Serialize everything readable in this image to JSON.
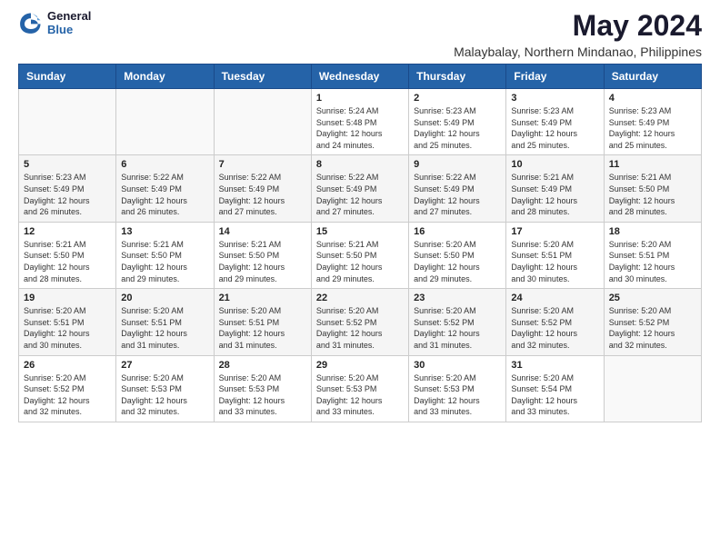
{
  "header": {
    "logo_general": "General",
    "logo_blue": "Blue",
    "month_title": "May 2024",
    "location": "Malaybalay, Northern Mindanao, Philippines"
  },
  "days_of_week": [
    "Sunday",
    "Monday",
    "Tuesday",
    "Wednesday",
    "Thursday",
    "Friday",
    "Saturday"
  ],
  "weeks": [
    [
      {
        "day": "",
        "info": ""
      },
      {
        "day": "",
        "info": ""
      },
      {
        "day": "",
        "info": ""
      },
      {
        "day": "1",
        "info": "Sunrise: 5:24 AM\nSunset: 5:48 PM\nDaylight: 12 hours\nand 24 minutes."
      },
      {
        "day": "2",
        "info": "Sunrise: 5:23 AM\nSunset: 5:49 PM\nDaylight: 12 hours\nand 25 minutes."
      },
      {
        "day": "3",
        "info": "Sunrise: 5:23 AM\nSunset: 5:49 PM\nDaylight: 12 hours\nand 25 minutes."
      },
      {
        "day": "4",
        "info": "Sunrise: 5:23 AM\nSunset: 5:49 PM\nDaylight: 12 hours\nand 25 minutes."
      }
    ],
    [
      {
        "day": "5",
        "info": "Sunrise: 5:23 AM\nSunset: 5:49 PM\nDaylight: 12 hours\nand 26 minutes."
      },
      {
        "day": "6",
        "info": "Sunrise: 5:22 AM\nSunset: 5:49 PM\nDaylight: 12 hours\nand 26 minutes."
      },
      {
        "day": "7",
        "info": "Sunrise: 5:22 AM\nSunset: 5:49 PM\nDaylight: 12 hours\nand 27 minutes."
      },
      {
        "day": "8",
        "info": "Sunrise: 5:22 AM\nSunset: 5:49 PM\nDaylight: 12 hours\nand 27 minutes."
      },
      {
        "day": "9",
        "info": "Sunrise: 5:22 AM\nSunset: 5:49 PM\nDaylight: 12 hours\nand 27 minutes."
      },
      {
        "day": "10",
        "info": "Sunrise: 5:21 AM\nSunset: 5:49 PM\nDaylight: 12 hours\nand 28 minutes."
      },
      {
        "day": "11",
        "info": "Sunrise: 5:21 AM\nSunset: 5:50 PM\nDaylight: 12 hours\nand 28 minutes."
      }
    ],
    [
      {
        "day": "12",
        "info": "Sunrise: 5:21 AM\nSunset: 5:50 PM\nDaylight: 12 hours\nand 28 minutes."
      },
      {
        "day": "13",
        "info": "Sunrise: 5:21 AM\nSunset: 5:50 PM\nDaylight: 12 hours\nand 29 minutes."
      },
      {
        "day": "14",
        "info": "Sunrise: 5:21 AM\nSunset: 5:50 PM\nDaylight: 12 hours\nand 29 minutes."
      },
      {
        "day": "15",
        "info": "Sunrise: 5:21 AM\nSunset: 5:50 PM\nDaylight: 12 hours\nand 29 minutes."
      },
      {
        "day": "16",
        "info": "Sunrise: 5:20 AM\nSunset: 5:50 PM\nDaylight: 12 hours\nand 29 minutes."
      },
      {
        "day": "17",
        "info": "Sunrise: 5:20 AM\nSunset: 5:51 PM\nDaylight: 12 hours\nand 30 minutes."
      },
      {
        "day": "18",
        "info": "Sunrise: 5:20 AM\nSunset: 5:51 PM\nDaylight: 12 hours\nand 30 minutes."
      }
    ],
    [
      {
        "day": "19",
        "info": "Sunrise: 5:20 AM\nSunset: 5:51 PM\nDaylight: 12 hours\nand 30 minutes."
      },
      {
        "day": "20",
        "info": "Sunrise: 5:20 AM\nSunset: 5:51 PM\nDaylight: 12 hours\nand 31 minutes."
      },
      {
        "day": "21",
        "info": "Sunrise: 5:20 AM\nSunset: 5:51 PM\nDaylight: 12 hours\nand 31 minutes."
      },
      {
        "day": "22",
        "info": "Sunrise: 5:20 AM\nSunset: 5:52 PM\nDaylight: 12 hours\nand 31 minutes."
      },
      {
        "day": "23",
        "info": "Sunrise: 5:20 AM\nSunset: 5:52 PM\nDaylight: 12 hours\nand 31 minutes."
      },
      {
        "day": "24",
        "info": "Sunrise: 5:20 AM\nSunset: 5:52 PM\nDaylight: 12 hours\nand 32 minutes."
      },
      {
        "day": "25",
        "info": "Sunrise: 5:20 AM\nSunset: 5:52 PM\nDaylight: 12 hours\nand 32 minutes."
      }
    ],
    [
      {
        "day": "26",
        "info": "Sunrise: 5:20 AM\nSunset: 5:52 PM\nDaylight: 12 hours\nand 32 minutes."
      },
      {
        "day": "27",
        "info": "Sunrise: 5:20 AM\nSunset: 5:53 PM\nDaylight: 12 hours\nand 32 minutes."
      },
      {
        "day": "28",
        "info": "Sunrise: 5:20 AM\nSunset: 5:53 PM\nDaylight: 12 hours\nand 33 minutes."
      },
      {
        "day": "29",
        "info": "Sunrise: 5:20 AM\nSunset: 5:53 PM\nDaylight: 12 hours\nand 33 minutes."
      },
      {
        "day": "30",
        "info": "Sunrise: 5:20 AM\nSunset: 5:53 PM\nDaylight: 12 hours\nand 33 minutes."
      },
      {
        "day": "31",
        "info": "Sunrise: 5:20 AM\nSunset: 5:54 PM\nDaylight: 12 hours\nand 33 minutes."
      },
      {
        "day": "",
        "info": ""
      }
    ]
  ]
}
